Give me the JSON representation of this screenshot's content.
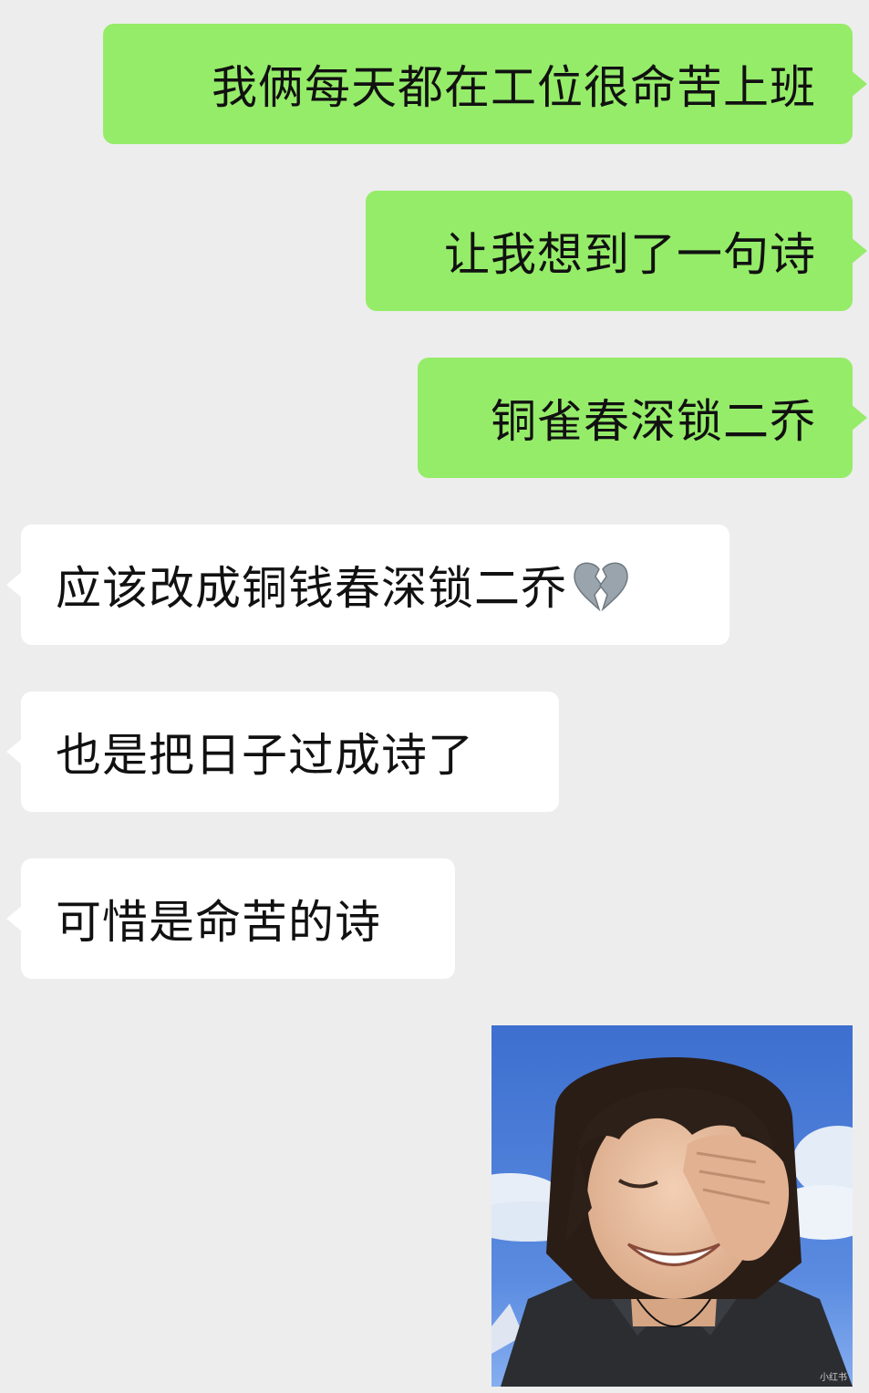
{
  "messages": [
    {
      "side": "sent",
      "text": "我俩每天都在工位很命苦上班"
    },
    {
      "side": "sent",
      "text": "让我想到了一句诗"
    },
    {
      "side": "sent",
      "text": "铜雀春深锁二乔"
    },
    {
      "side": "received",
      "text": "应该改成铜钱春深锁二乔",
      "emoji": "broken-heart"
    },
    {
      "side": "received",
      "text": "也是把日子过成诗了"
    },
    {
      "side": "received",
      "text": "可惜是命苦的诗"
    },
    {
      "side": "sent",
      "type": "image",
      "description_icon": "laughing-facepalm-meme"
    }
  ],
  "watermark": "小红书",
  "colors": {
    "background": "#ededed",
    "sent_bubble": "#95ec69",
    "received_bubble": "#ffffff",
    "text": "#111111"
  }
}
